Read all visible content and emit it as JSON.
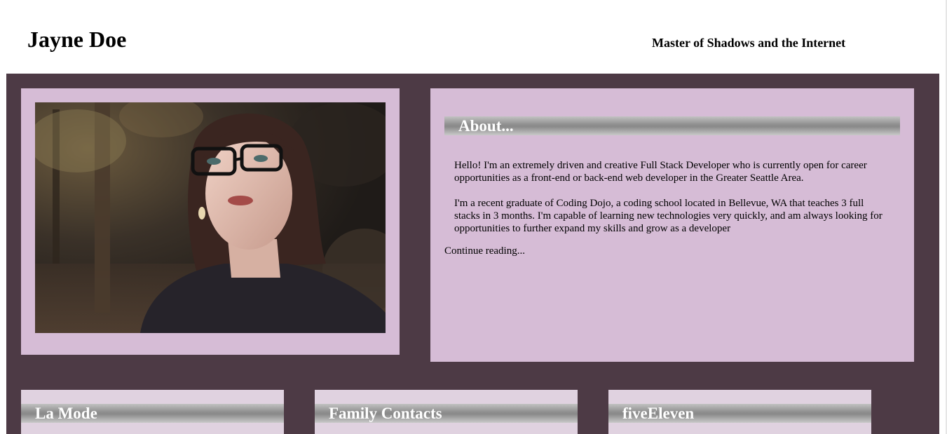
{
  "header": {
    "name": "Jayne Doe",
    "tagline": "Master of Shadows and the Internet"
  },
  "profile": {
    "photo_alt": "Portrait of Jayne Doe"
  },
  "about": {
    "heading": "About...",
    "paragraphs": [
      "Hello! I'm an extremely driven and creative Full Stack Developer who is currently open for career opportunities as a front-end or back-end web developer in the Greater Seattle Area.",
      "I'm a recent graduate of Coding Dojo, a coding school located in Bellevue, WA that teaches 3 full stacks in 3 months. I'm capable of learning new technologies very quickly, and am always looking for opportunities to further expand my skills and grow as a developer"
    ],
    "continue_link": "Continue reading..."
  },
  "projects": [
    {
      "title": "La Mode"
    },
    {
      "title": "Family Contacts"
    },
    {
      "title": "fiveEleven"
    }
  ],
  "colors": {
    "main_background": "#4d3a45",
    "card_background": "#d6bcd6",
    "project_card_background": "#e0d2e0",
    "heading_text": "#ffffff"
  }
}
